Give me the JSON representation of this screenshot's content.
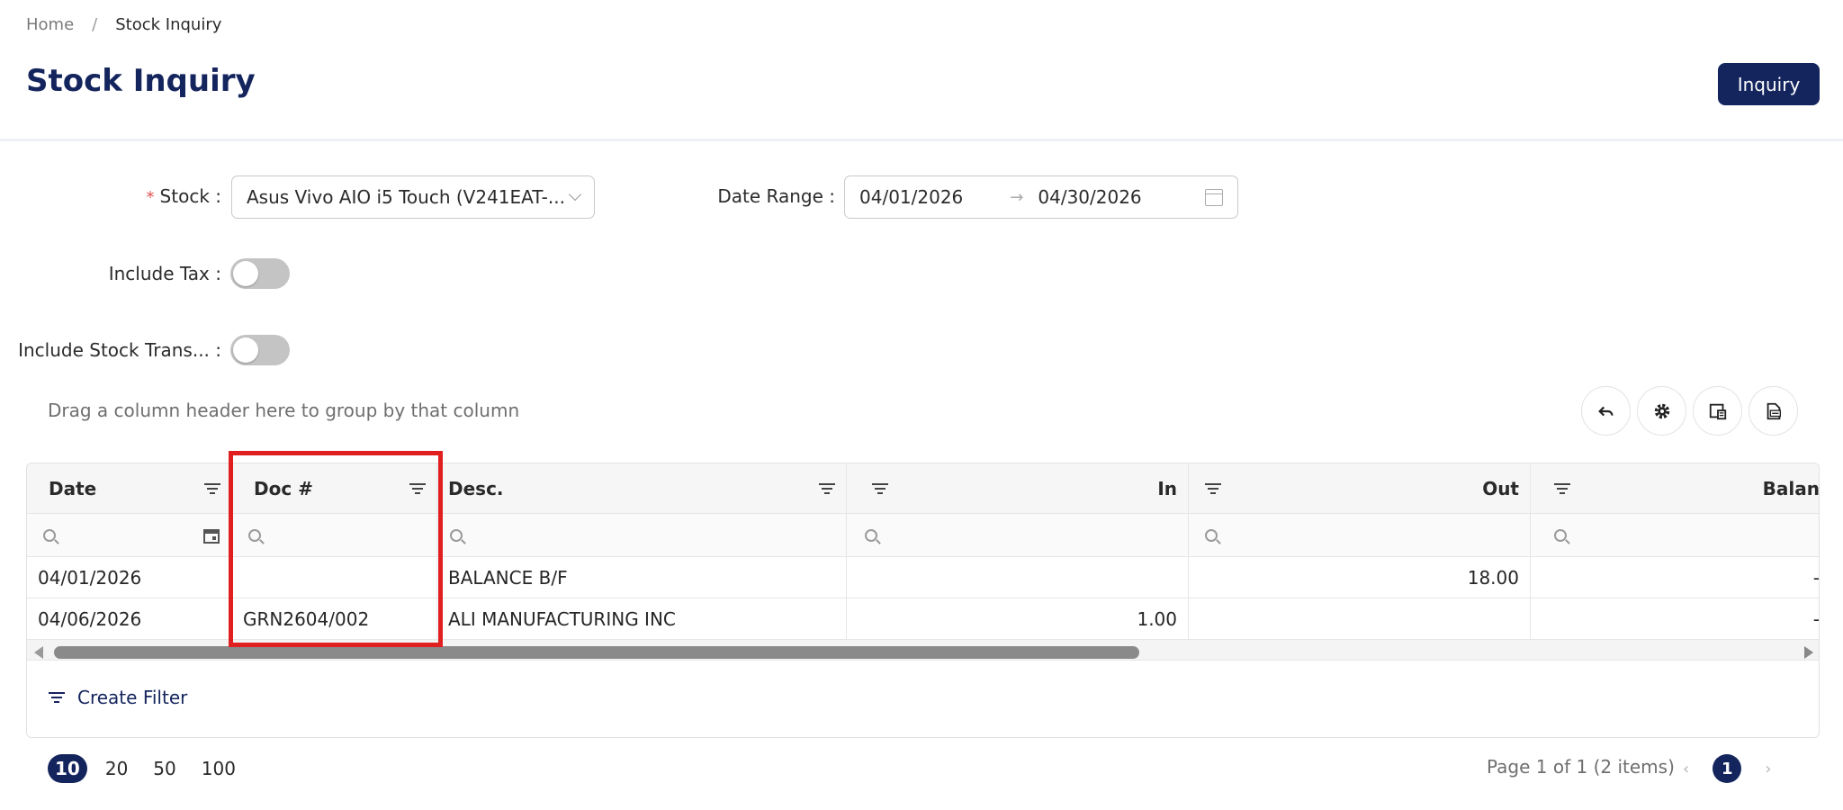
{
  "breadcrumb": {
    "home": "Home",
    "separator": "/",
    "current": "Stock Inquiry"
  },
  "header": {
    "title": "Stock Inquiry",
    "inquiry_button": "Inquiry"
  },
  "form": {
    "stock_required_mark": "*",
    "stock_label": "Stock :",
    "stock_value": "Asus Vivo AIO i5 Touch (V241EAT-...",
    "date_range_label": "Date Range :",
    "date_from": "04/01/2026",
    "date_to": "04/30/2026",
    "include_tax_label": "Include Tax :",
    "include_tax_on": false,
    "include_stock_transfer_label": "Include Stock Trans... :",
    "include_stock_transfer_on": false
  },
  "grid": {
    "group_hint": "Drag a column header here to group by that column",
    "toolbar_icons": [
      "undo-icon",
      "gear-icon",
      "column-chooser-icon",
      "export-pdf-icon"
    ],
    "columns": [
      "Date",
      "Doc #",
      "Desc.",
      "In",
      "Out",
      "Balan"
    ],
    "rows": [
      {
        "date": "04/01/2026",
        "doc": "",
        "desc": "BALANCE B/F",
        "in": "",
        "out": "18.00",
        "balance": "-"
      },
      {
        "date": "04/06/2026",
        "doc": "GRN2604/002",
        "desc": "ALI MANUFACTURING INC",
        "in": "1.00",
        "out": "",
        "balance": "-"
      }
    ],
    "create_filter": "Create Filter"
  },
  "pager": {
    "page_sizes": [
      "10",
      "20",
      "50",
      "100"
    ],
    "active_page_size": "10",
    "page_info": "Page 1 of 1 (2 items)",
    "prev": "‹",
    "current_page": "1",
    "next": "›"
  },
  "colors": {
    "primary": "#14255e",
    "link": "#4ea6e6",
    "highlight": "#e02020",
    "required": "#e05252"
  }
}
